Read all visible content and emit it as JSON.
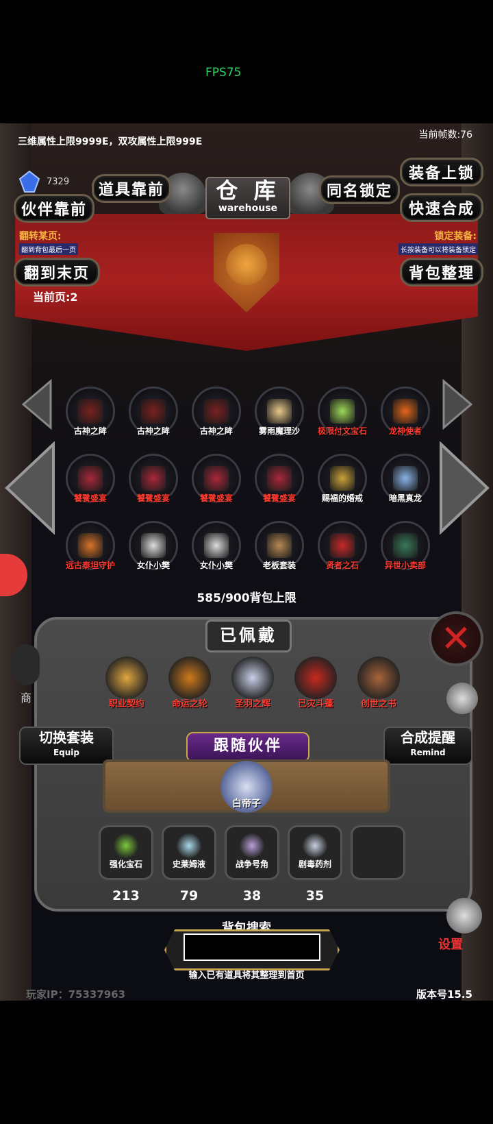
{
  "overlay": {
    "fps_label": "FPS75"
  },
  "header": {
    "stat_cap": "三维属性上限9999E，双攻属性上限999E",
    "current_fps": "当前帧数:76",
    "gem_count": "7329"
  },
  "title": {
    "cn": "仓 库",
    "en": "warehouse"
  },
  "buttons": {
    "item_front": "道具靠前",
    "partner_front": "伙伴靠前",
    "same_name_lock": "同名锁定",
    "equip_lock": "装备上锁",
    "quick_craft": "快速合成",
    "go_last_page": "翻到末页",
    "bag_sort": "背包整理"
  },
  "notes": {
    "flip_title": "翻转某页:",
    "flip_sub": "翻到背包最后一页",
    "lock_title": "锁定装备:",
    "lock_sub": "长按装备可以将装备锁定"
  },
  "page": {
    "current": "当前页:2"
  },
  "grid": [
    {
      "label": "古神之眸",
      "red": false,
      "color": "#7a2020"
    },
    {
      "label": "古神之眸",
      "red": false,
      "color": "#7a2020"
    },
    {
      "label": "古神之眸",
      "red": false,
      "color": "#7a2020"
    },
    {
      "label": "雾雨魔理沙",
      "red": false,
      "color": "#e8c88a"
    },
    {
      "label": "极限付文宝石",
      "red": true,
      "color": "#9fd85a"
    },
    {
      "label": "龙神使者",
      "red": true,
      "color": "#e2661a"
    },
    {
      "label": "饕餮盛宴",
      "red": true,
      "color": "#a8283a"
    },
    {
      "label": "饕餮盛宴",
      "red": true,
      "color": "#a8283a"
    },
    {
      "label": "饕餮盛宴",
      "red": true,
      "color": "#a8283a"
    },
    {
      "label": "饕餮盛宴",
      "red": true,
      "color": "#a8283a"
    },
    {
      "label": "赐福的婚戒",
      "red": false,
      "color": "#c9a23a"
    },
    {
      "label": "暗黑真龙",
      "red": false,
      "color": "#8ab4e8"
    },
    {
      "label": "远古泰坦守护",
      "red": true,
      "color": "#d8732a"
    },
    {
      "label": "女仆小樊",
      "red": false,
      "color": "#dcdcdc"
    },
    {
      "label": "女仆小樊",
      "red": false,
      "color": "#dcdcdc"
    },
    {
      "label": "老板套装",
      "red": false,
      "color": "#b78a55"
    },
    {
      "label": "贤者之石",
      "red": true,
      "color": "#c82a2a"
    },
    {
      "label": "异世小卖部",
      "red": true,
      "color": "#3a7a5a"
    }
  ],
  "capacity": "585/900背包上限",
  "worn": {
    "title": "已佩戴",
    "items": [
      {
        "label": "职业契约",
        "color": "#e0a640"
      },
      {
        "label": "命运之轮",
        "color": "#d07a1a"
      },
      {
        "label": "圣羽之辉",
        "color": "#c8d0e8"
      },
      {
        "label": "已灾斗蓬",
        "color": "#c8281e"
      },
      {
        "label": "创世之书",
        "color": "#a8643a"
      }
    ]
  },
  "switch_set": {
    "cn": "切换套装",
    "en": "Equip"
  },
  "craft_remind": {
    "cn": "合成提醒",
    "en": "Remind"
  },
  "follow": {
    "title": "跟随伙伴",
    "partner": "白帝子"
  },
  "consumables": [
    {
      "label": "强化宝石",
      "count": "213",
      "color": "#7ac83a"
    },
    {
      "label": "史莱姆液",
      "count": "79",
      "color": "#a8d8e8"
    },
    {
      "label": "战争号角",
      "count": "38",
      "color": "#b8a0d8"
    },
    {
      "label": "剧毒药剂",
      "count": "35",
      "color": "#c8d0e0"
    }
  ],
  "search": {
    "label": "背包搜索",
    "value": "",
    "hint": "输入已有道具将其整理到首页"
  },
  "footer": {
    "ip": "玩家IP：75337963",
    "version": "版本号15.5"
  },
  "side": {
    "shop": "商",
    "settings": "设置"
  }
}
